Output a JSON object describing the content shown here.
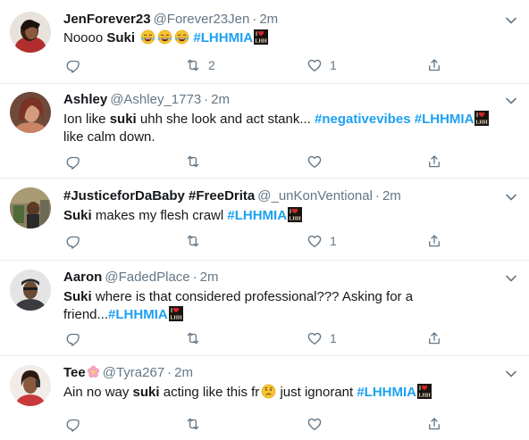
{
  "tweets": [
    {
      "name": "JenForever23",
      "handle": "@Forever23Jen",
      "sep": "·",
      "time": "2m",
      "parts": {
        "a": "Noooo ",
        "b": "Suki",
        "hashtag": "#LHHMIA",
        "c": ""
      },
      "retweets": "2",
      "likes": "1"
    },
    {
      "name": "Ashley",
      "handle": "@Ashley_1773",
      "sep": "·",
      "time": "2m",
      "parts": {
        "a": "Ion like ",
        "b": "suki",
        "c": " uhh she look and act stank... ",
        "tag1": "#negativevibes",
        "hashtag": "#LHHMIA",
        "d": "like calm down."
      },
      "retweets": "",
      "likes": ""
    },
    {
      "name": "#JusticeforDaBaby #FreeDrita",
      "handle": "@_unKonVentional",
      "sep": "·",
      "time": "2m",
      "parts": {
        "b": "Suki",
        "c": " makes my flesh crawl ",
        "hashtag": "#LHHMIA"
      },
      "retweets": "",
      "likes": "1"
    },
    {
      "name": "Aaron",
      "handle": "@FadedPlace",
      "sep": "·",
      "time": "2m",
      "parts": {
        "b": "Suki",
        "c": " where is that considered professional??? Asking for a",
        "d": "friend...",
        "hashtag": "#LHHMIA"
      },
      "retweets": "",
      "likes": "1"
    },
    {
      "name": "Tee",
      "handle": "@Tyra267",
      "sep": "·",
      "time": "2m",
      "parts": {
        "a": "Ain no way ",
        "b": "suki",
        "c": " acting like this fr",
        "d": " just ignorant  ",
        "hashtag": "#LHHMIA"
      },
      "retweets": "",
      "likes": ""
    }
  ],
  "icons": {
    "reply": "reply-icon",
    "retweet": "retweet-icon",
    "like": "heart-icon",
    "share": "share-icon",
    "caret": "chevron-down-icon",
    "lhh_badge": "lhh-heart-badge-icon",
    "laughing": "tears-of-joy-emoji-icon",
    "thinking": "confused-emoji-icon",
    "flower": "flower-emoji-icon"
  },
  "colors": {
    "hashtag": "#1da1f2",
    "secondary_text": "#657786",
    "divider": "#e6ecf0"
  }
}
